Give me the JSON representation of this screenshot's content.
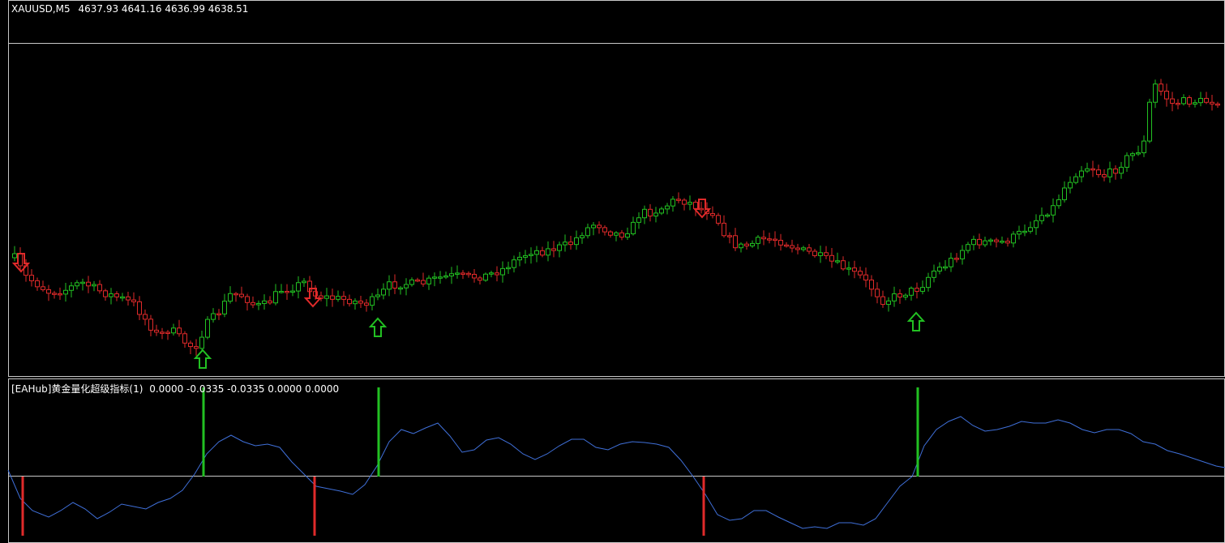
{
  "main_chart": {
    "symbol": "XAUUSD,M5",
    "ohlc": "4637.93 4641.16 4636.99 4638.51",
    "colors": {
      "bull": "#22c022",
      "bear": "#e02a2a",
      "background": "#000000",
      "grid": "#c8c8c8"
    },
    "buy_signal_icon": "green-up-arrow-icon",
    "sell_signal_icon": "red-down-arrow-icon"
  },
  "indicator": {
    "name": "[EAHub]黄金量化超级指标(1)",
    "values": "0.0000 -0.0335 -0.0335 0.0000 0.0000",
    "colors": {
      "line": "#3f6fd8",
      "buy_bar": "#22c022",
      "sell_bar": "#e02a2a",
      "zero_line": "#c8c8c8"
    }
  }
}
